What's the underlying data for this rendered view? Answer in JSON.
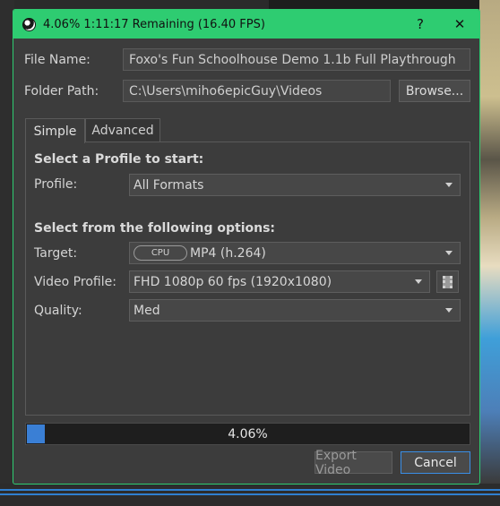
{
  "window": {
    "title": "4.06%  1:11:17 Remaining (16.40 FPS)",
    "help_label": "?",
    "close_label": "✕",
    "accent": "#2ecc71"
  },
  "form": {
    "file_name_label": "File Name:",
    "file_name_value": "Foxo's Fun Schoolhouse Demo 1.1b Full Playthrough",
    "folder_path_label": "Folder Path:",
    "folder_path_value": "C:\\Users\\miho6epicGuy\\Videos",
    "browse_label": "Browse..."
  },
  "tabs": [
    {
      "label": "Simple",
      "active": true
    },
    {
      "label": "Advanced",
      "active": false
    }
  ],
  "simple": {
    "profile_heading": "Select a Profile to start:",
    "profile_label": "Profile:",
    "profile_value": "All Formats",
    "options_heading": "Select from the following options:",
    "target_label": "Target:",
    "target_badge": "CPU",
    "target_value": "MP4 (h.264)",
    "video_profile_label": "Video Profile:",
    "video_profile_value": "FHD 1080p 60 fps (1920x1080)",
    "quality_label": "Quality:",
    "quality_value": "Med"
  },
  "progress": {
    "percent": 4.06,
    "label": "4.06%",
    "color": "#3a7fd5"
  },
  "buttons": {
    "export_label": "Export Video",
    "cancel_label": "Cancel"
  }
}
